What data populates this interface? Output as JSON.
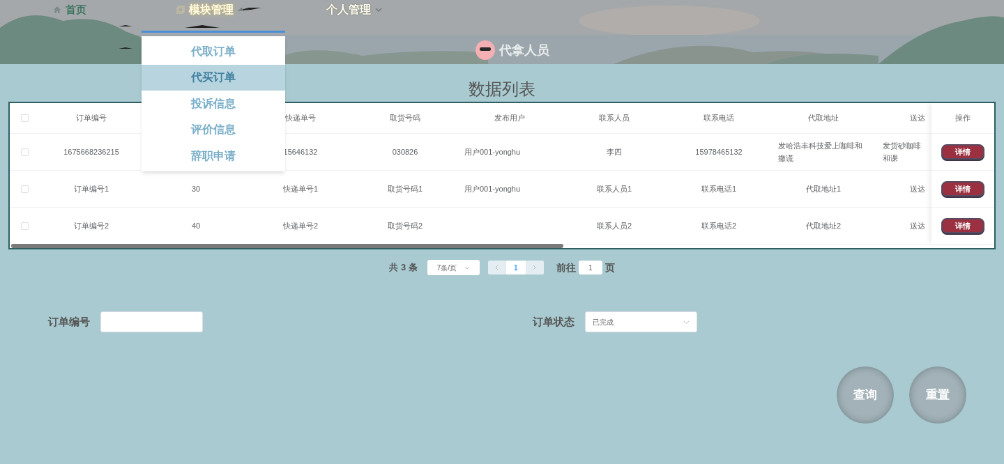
{
  "nav": [
    {
      "label": "首页",
      "selected": false
    },
    {
      "label": "模块管理",
      "expanded": true,
      "selected": true
    },
    {
      "label": "个人管理",
      "expanded": false,
      "selected": false
    }
  ],
  "user": {
    "name": "代拿人员"
  },
  "menu": [
    {
      "label": "代取订单",
      "selected": false
    },
    {
      "label": "代买订单",
      "selected": true
    },
    {
      "label": "投诉信息",
      "selected": false
    },
    {
      "label": "评价信息",
      "selected": false
    },
    {
      "label": "辞职申请",
      "selected": false
    }
  ],
  "page_title": "数据列表",
  "table": {
    "header_checked": false,
    "columns": [
      "订单编号",
      null,
      "快递单号",
      "取货号码",
      "发布用户",
      "联系人员",
      "联系电话",
      "代取地址",
      "送达"
    ],
    "action_column": "操作",
    "rows": [
      {
        "checked": false,
        "cells": [
          "1675668236215",
          null,
          "15646132",
          "030826",
          "用户001-yonghu",
          "李四",
          "15978465132",
          "发哈浩丰科技爱上咖啡和撒谎",
          "发货砂咖啡和课"
        ],
        "action": "详情"
      },
      {
        "checked": false,
        "cells": [
          "订单编号1",
          "30",
          "快递单号1",
          "取货号码1",
          "用户001-yonghu",
          "联系人员1",
          "联系电话1",
          "代取地址1",
          "送达"
        ],
        "action": "详情"
      },
      {
        "checked": false,
        "cells": [
          "订单编号2",
          "40",
          "快递单号2",
          "取货号码2",
          null,
          "联系人员2",
          "联系电话2",
          "代取地址2",
          "送达"
        ],
        "action": "详情"
      }
    ]
  },
  "pagination": {
    "total": "共 3 条",
    "page_size": "7条/页",
    "pages": [
      {
        "label": "1",
        "selected": true
      }
    ],
    "goto_label": "前往",
    "goto_value": "1",
    "goto_suffix": "页"
  },
  "search": {
    "fields": [
      {
        "label": "订单编号",
        "kind": "input"
      },
      {
        "label": "订单状态",
        "kind": "select",
        "value": "已完成"
      }
    ],
    "buttons": [
      "查询",
      "重置"
    ]
  }
}
